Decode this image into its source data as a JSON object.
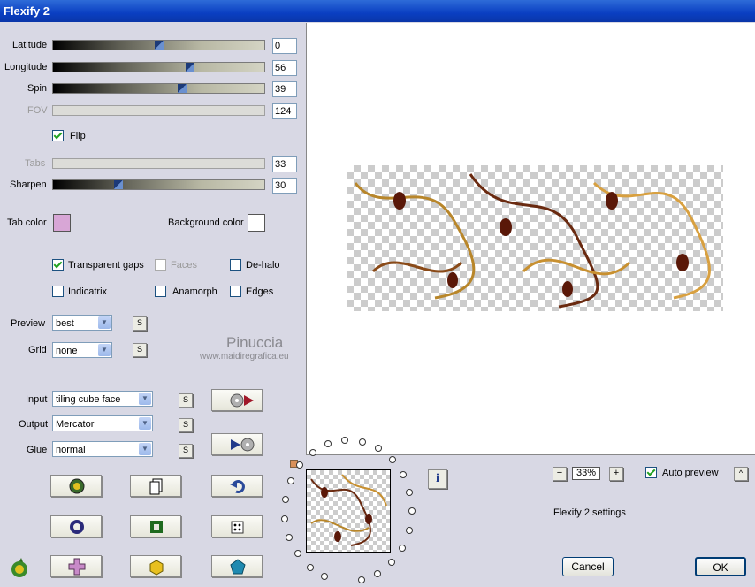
{
  "window": {
    "title": "Flexify 2"
  },
  "sliders": {
    "latitude": {
      "label": "Latitude",
      "value": "0",
      "level": 0.5,
      "enabled": true
    },
    "longitude": {
      "label": "Longitude",
      "value": "56",
      "level": 0.65,
      "enabled": true
    },
    "spin": {
      "label": "Spin",
      "value": "39",
      "level": 0.61,
      "enabled": true
    },
    "fov": {
      "label": "FOV",
      "value": "124",
      "enabled": false
    },
    "tabs": {
      "label": "Tabs",
      "value": "33",
      "enabled": false
    },
    "sharpen": {
      "label": "Sharpen",
      "value": "30",
      "level": 0.31,
      "enabled": true
    }
  },
  "flip": {
    "label": "Flip",
    "checked": true
  },
  "colors": {
    "tab_color_label": "Tab color",
    "tab_color": "#d8a6d6",
    "background_color_label": "Background color",
    "background_color": "#ffffff"
  },
  "options": {
    "transparent_gaps": {
      "label": "Transparent gaps",
      "checked": true
    },
    "faces": {
      "label": "Faces",
      "checked": false,
      "enabled": false
    },
    "de_halo": {
      "label": "De-halo",
      "checked": false
    },
    "indicatrix": {
      "label": "Indicatrix",
      "checked": false
    },
    "anamorph": {
      "label": "Anamorph",
      "checked": false
    },
    "edges": {
      "label": "Edges",
      "checked": false
    }
  },
  "selects": {
    "preview": {
      "label": "Preview",
      "value": "best",
      "s": "S"
    },
    "grid": {
      "label": "Grid",
      "value": "none",
      "s": "S"
    },
    "input": {
      "label": "Input",
      "value": "tiling cube face",
      "s": "S"
    },
    "output": {
      "label": "Output",
      "value": "Mercator",
      "s": "S"
    },
    "glue": {
      "label": "Glue",
      "value": "normal",
      "s": "S"
    }
  },
  "watermark": {
    "name": "Pinuccia",
    "url": "www.maidiregrafica.eu"
  },
  "zoom": {
    "minus": "−",
    "value": "33%",
    "plus": "+"
  },
  "auto_preview": {
    "label": "Auto preview",
    "checked": true,
    "toggle": "^"
  },
  "settings_text": "Flexify 2 settings",
  "buttons": {
    "cancel": "Cancel",
    "ok": "OK",
    "info": "i"
  }
}
